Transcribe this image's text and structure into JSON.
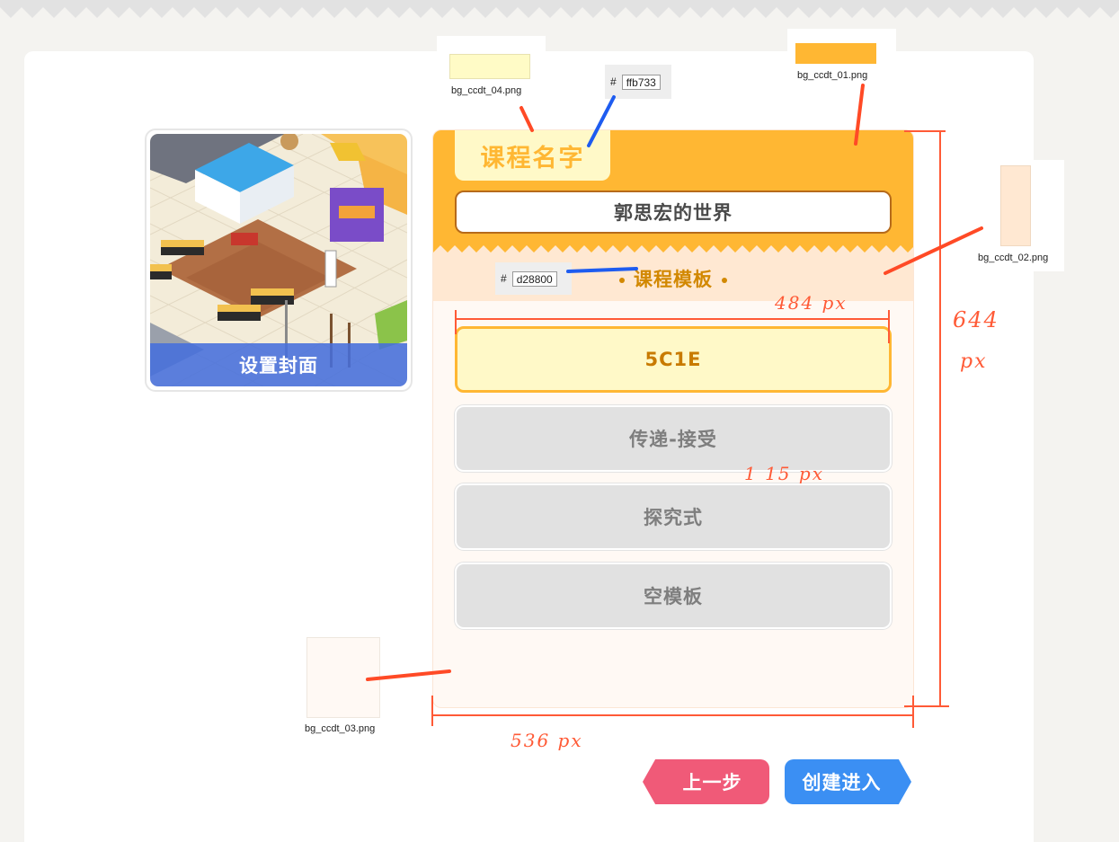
{
  "cover": {
    "label": "设置封面"
  },
  "course": {
    "name_tab": "课程名字",
    "name_value": "郭思宏的世界",
    "template_heading": "课程模板",
    "templates": [
      {
        "label": "5C1E",
        "selected": true
      },
      {
        "label": "传递-接受",
        "selected": false
      },
      {
        "label": "探究式",
        "selected": false
      },
      {
        "label": "空模板",
        "selected": false
      }
    ]
  },
  "buttons": {
    "prev": "上一步",
    "next": "创建进入"
  },
  "swatches": {
    "bg4": "bg_ccdt_04.png",
    "bg1": "bg_ccdt_01.png",
    "bg2": "bg_ccdt_02.png",
    "bg3": "bg_ccdt_03.png"
  },
  "hex_labels": {
    "hash": "#",
    "name_tab_color": "ffb733",
    "heading_color": "d28800"
  },
  "annotations": {
    "width_484": "484 px",
    "height_644": "644",
    "height_unit": "px",
    "gap_115": "1 15 px",
    "width_536": "536 px"
  },
  "colors": {
    "orange": "#ffb733",
    "heading": "#d28800",
    "cream": "#fff9c8",
    "peach": "#ffe8d2",
    "card_bg": "#fff9f4",
    "prev_btn": "#f05a78",
    "next_btn": "#3b8ff3",
    "cover_label_bg": "#466edc",
    "annotation": "#ff5a36"
  }
}
